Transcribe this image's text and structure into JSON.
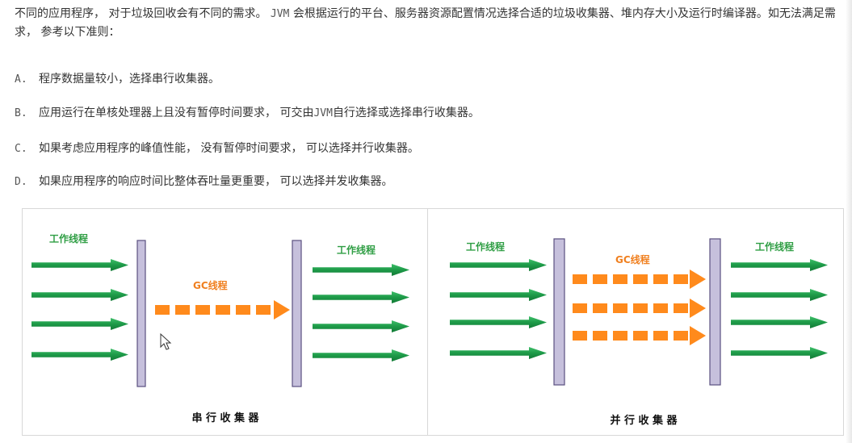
{
  "intro": {
    "part1": "不同的应用程序， 对于垃圾回收会有不同的需求。 ",
    "jvm": "JVM",
    "part2": " 会根据运行的平台、服务器资源配置情况选择合适的垃圾收集器、堆内存大小及运行时编译器。如无法满足需求， 参考以下准则："
  },
  "items": [
    {
      "marker": "A.",
      "text": "程序数据量较小，选择串行收集器。"
    },
    {
      "marker": "B.",
      "text_before": "应用运行在单核处理器上且没有暂停时间要求， 可交由",
      "jvm": "JVM",
      "text_after": "自行选择或选择串行收集器。"
    },
    {
      "marker": "C.",
      "text": "如果考虑应用程序的峰值性能， 没有暂停时间要求， 可以选择并行收集器。"
    },
    {
      "marker": "D.",
      "text": "如果应用程序的响应时间比整体吞吐量更重要， 可以选择并发收集器。"
    }
  ],
  "diagram": {
    "serial": {
      "work_thread_left": "工作线程",
      "gc_thread": "GC线程",
      "work_thread_right": "工作线程",
      "caption": "串 行 收 集 器"
    },
    "parallel": {
      "work_thread_left": "工作线程",
      "gc_thread": "GC线程",
      "work_thread_right": "工作线程",
      "caption": "并 行 收 集 器"
    },
    "colors": {
      "green_arrow": "#1d9a48",
      "orange_arrow": "#ff8a1c",
      "bar_fill": "#c6c0dc",
      "bar_stroke": "#5a5080",
      "label_green": "#2f9e44",
      "label_orange": "#f08020"
    }
  }
}
